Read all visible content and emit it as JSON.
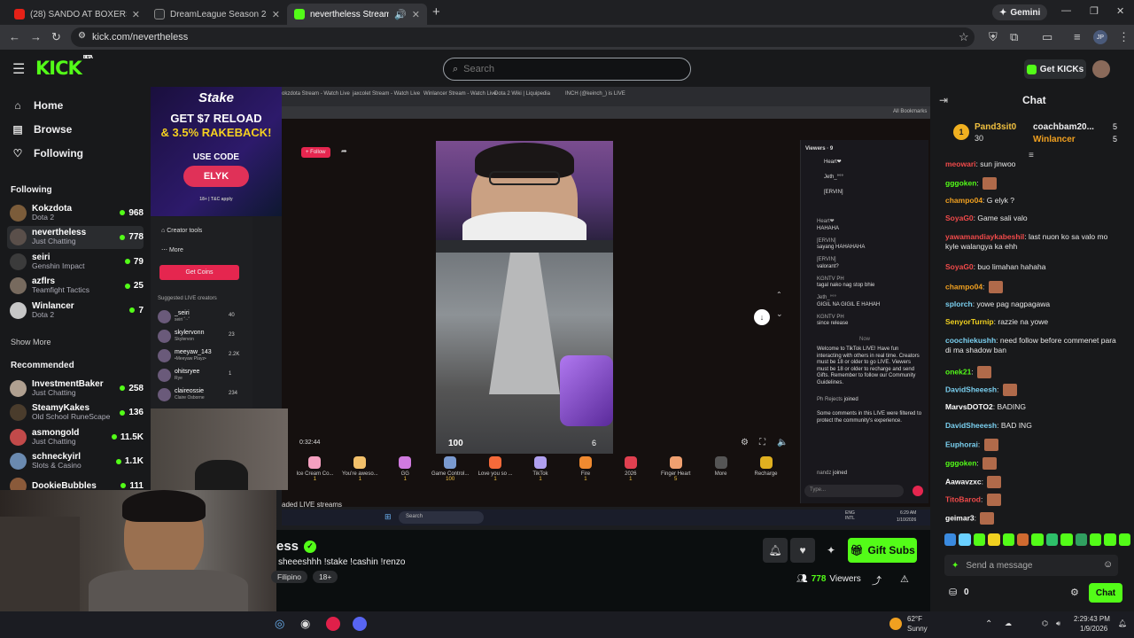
{
  "browser_tabs": [
    {
      "title": "(28) SANDO AT BOXERS - YouTube",
      "fav": "#e62117"
    },
    {
      "title": "DreamLeague Season 28: South...",
      "fav": "#2a2c2f"
    },
    {
      "title": "nevertheless Stream - Watch...",
      "fav": "#53fc18"
    }
  ],
  "browser": {
    "new_tab": "+",
    "gemini": "Gemini",
    "url": "kick.com/nevertheless",
    "profile": "JP"
  },
  "header": {
    "logo": "KICK",
    "beta": "BETA",
    "search_placeholder": "Search",
    "get_kicks": "Get KICKs"
  },
  "sidebar": {
    "nav": [
      {
        "label": "Home",
        "icon": "home-icon"
      },
      {
        "label": "Browse",
        "icon": "browse-icon"
      },
      {
        "label": "Following",
        "icon": "heart-icon"
      }
    ],
    "following_title": "Following",
    "following": [
      {
        "name": "Kokzdota",
        "category": "Dota 2",
        "viewers": "968",
        "color": "#7b5c3a"
      },
      {
        "name": "nevertheless",
        "category": "Just Chatting",
        "viewers": "778",
        "color": "#5a4f4a"
      },
      {
        "name": "seiri",
        "category": "Genshin Impact",
        "viewers": "79",
        "color": "#3b3b3b"
      },
      {
        "name": "azflrs",
        "category": "Teamfight Tactics",
        "viewers": "25",
        "color": "#776a5e"
      },
      {
        "name": "Winlancer",
        "category": "Dota 2",
        "viewers": "7",
        "color": "#c7c7c7"
      }
    ],
    "show_more": "Show More",
    "recommended_title": "Recommended",
    "recommended": [
      {
        "name": "InvestmentBaker",
        "category": "Just Chatting",
        "viewers": "258",
        "color": "#b0a090"
      },
      {
        "name": "SteamyKakes",
        "category": "Old School RuneScape",
        "viewers": "136",
        "color": "#4a3c2c"
      },
      {
        "name": "asmongold",
        "category": "Just Chatting",
        "viewers": "11.5K",
        "color": "#c24a4a"
      },
      {
        "name": "schneckyirl",
        "category": "Slots & Casino",
        "viewers": "1.1K",
        "color": "#6a8ab0"
      },
      {
        "name": "DookieBubbles",
        "category": "",
        "viewers": "111",
        "color": "#8a5a3a"
      }
    ]
  },
  "inner_browser": {
    "tabs": [
      "okzdota Stream - Watch Live",
      "jaxcolet Stream - Watch Live",
      "Winlancer Stream - Watch Live",
      "Dota 2 Wiki | Liquipedia",
      "INCH (@keinch_) is LIVE"
    ],
    "bookmarks": "All Bookmarks",
    "follow": "+ Follow",
    "stream_time": "0:32:44",
    "hp": "100",
    "ammo": "6",
    "viewers_label": "Viewers · 9",
    "top_viewers": [
      "Heart❤",
      "Jeth_°°°",
      "[ERVIN]"
    ],
    "chat": [
      {
        "user": "Heart❤",
        "text": "HAHAHA"
      },
      {
        "user": "[ERVIN]",
        "text": "sayang HAHAHAHA"
      },
      {
        "user": "[ERVIN]",
        "text": "valorant?"
      },
      {
        "user": "KGNTV PH",
        "text": "tagal nako nag stop bhie"
      },
      {
        "user": "Jeth_°°°",
        "text": "GIGIL NA GIGIL E HAHAH"
      },
      {
        "user": "KGNTV PH",
        "text": "since release"
      }
    ],
    "now": "Now",
    "welcome": "Welcome to TikTok LIVE! Have fun interacting with others in real time. Creators must be 18 or older to go LIVE. Viewers must be 18 or older to recharge and send Gifts. Remember to follow our Community Guidelines.",
    "ph_rejects": "Ph Rejects",
    "joined": "joined",
    "filtered": "Some comments in this LIVE were filtered to protect the community's experience.",
    "nandz": "nandz",
    "type_placeholder": "Type...",
    "gifts": [
      {
        "name": "Ice Cream Co...",
        "price": "1",
        "color": "#f5a0c0"
      },
      {
        "name": "You're aweso...",
        "price": "1",
        "color": "#f2c06a"
      },
      {
        "name": "GG",
        "price": "1",
        "color": "#d07adf"
      },
      {
        "name": "Game Control...",
        "price": "100",
        "color": "#7a9ad0"
      },
      {
        "name": "Love you so ...",
        "price": "1",
        "color": "#f56a3a"
      },
      {
        "name": "TikTok",
        "price": "1",
        "color": "#b0a0f0"
      },
      {
        "name": "Fire",
        "price": "1",
        "color": "#f08a30"
      },
      {
        "name": "2026",
        "price": "1",
        "color": "#e04050"
      },
      {
        "name": "Finger Heart",
        "price": "5",
        "color": "#f0a070"
      },
      {
        "name": "More",
        "price": "",
        "color": "#555"
      },
      {
        "name": "Recharge",
        "price": "",
        "color": "#e0b020"
      }
    ],
    "lower_text": "aded LIVE streams",
    "search": "Search",
    "lang": "ENG INTL",
    "time": "6:29 AM",
    "date": "1/10/2026"
  },
  "panel": {
    "creator_tools": "Creator tools",
    "more": "More",
    "get_coins": "Get Coins",
    "suggested": "Suggested LIVE creators",
    "creators": [
      {
        "name": "_seiri",
        "sub": "seiri ˚‧·˚",
        "count": "40"
      },
      {
        "name": "skylervonn",
        "sub": "Skylervon",
        "count": "23"
      },
      {
        "name": "meeyaw_143",
        "sub": "•Meeyaw Playz•",
        "count": "2.2K"
      },
      {
        "name": "ohitsryee",
        "sub": "Rye",
        "count": "1"
      },
      {
        "name": "claireossie",
        "sub": "Claire Osborne",
        "count": "234"
      }
    ]
  },
  "ad": {
    "brand": "Stake",
    "line1": "GET $7 RELOAD",
    "line2": "& 3.5% RAKEBACK!",
    "use_code": "USE CODE",
    "code": "ELYK",
    "fine": "18+ | T&C apply"
  },
  "stream": {
    "title_end": "ess",
    "stream_title": "sheeeshhh !stake !cashin !renzo",
    "tags": [
      "Filipino",
      "18+"
    ],
    "viewers": "778",
    "viewers_label": "Viewers",
    "gift_subs": "Gift Subs"
  },
  "chat": {
    "title": "Chat",
    "leaders": [
      {
        "rank": "1",
        "name": "Pand3sit0",
        "count": "30"
      },
      {
        "name": "coachbam20...",
        "count": "5"
      },
      {
        "name": "Winlancer",
        "count": "5"
      }
    ],
    "messages": [
      {
        "user": "meowari",
        "color": "#f04a4a",
        "text": "sun jinwoo",
        "emote": false
      },
      {
        "user": "gggoken",
        "color": "#53fc18",
        "text": "",
        "emote": true
      },
      {
        "user": "champo04",
        "color": "#f0a020",
        "text": "G elyk ?",
        "emote": false
      },
      {
        "user": "SoyaG0",
        "color": "#f04a4a",
        "text": "Game sali valo",
        "emote": false
      },
      {
        "user": "yawamandiaykabeshil",
        "color": "#f04a4a",
        "text": "last nuon ko sa valo mo kyle walangya ka ehh",
        "emote": false
      },
      {
        "user": "champo04",
        "color": "#f0a020",
        "text": "",
        "emote": true
      },
      {
        "user": "SoyaG0",
        "color": "#f04a4a",
        "text": "buo limahan hahaha",
        "emote": false
      },
      {
        "user": "champo04",
        "color": "#f0a020",
        "text": "",
        "emote": true
      },
      {
        "user": "splorch",
        "color": "#7ad0f0",
        "text": "yowe pag nagpagawa",
        "emote": false
      },
      {
        "user": "SenyorTurnip",
        "color": "#f0d020",
        "text": "razzie na yowe",
        "emote": false
      },
      {
        "user": "coochiekushh",
        "color": "#7ad0f0",
        "text": "need follow before commenet para di ma shadow ban",
        "emote": false
      },
      {
        "user": "onek21",
        "color": "#53fc18",
        "text": "",
        "emote": true
      },
      {
        "user": "DavidSheeesh",
        "color": "#7ad0f0",
        "text": "",
        "emote": true
      },
      {
        "user": "MarvsDOTO2",
        "color": "#fff",
        "text": "BADING",
        "emote": false
      },
      {
        "user": "DavidSheeesh",
        "color": "#7ad0f0",
        "text": "BAD ING",
        "emote": false
      },
      {
        "user": "Euphorai",
        "color": "#7ad0f0",
        "text": "",
        "emote": true
      },
      {
        "user": "gggoken",
        "color": "#53fc18",
        "text": "",
        "emote": true
      },
      {
        "user": "Aawavzxc",
        "color": "#fff",
        "text": "",
        "emote": true
      },
      {
        "user": "TitoBarod",
        "color": "#f04a4a",
        "text": "",
        "emote": true
      },
      {
        "user": "geimar3",
        "color": "#fff",
        "text": "",
        "emote": true
      }
    ],
    "send_placeholder": "Send a message",
    "points": "0",
    "chat_button": "Chat"
  },
  "taskbar": {
    "weather_temp": "62°F",
    "weather_cond": "Sunny",
    "time": "2:29:43 PM",
    "date": "1/9/2026"
  }
}
